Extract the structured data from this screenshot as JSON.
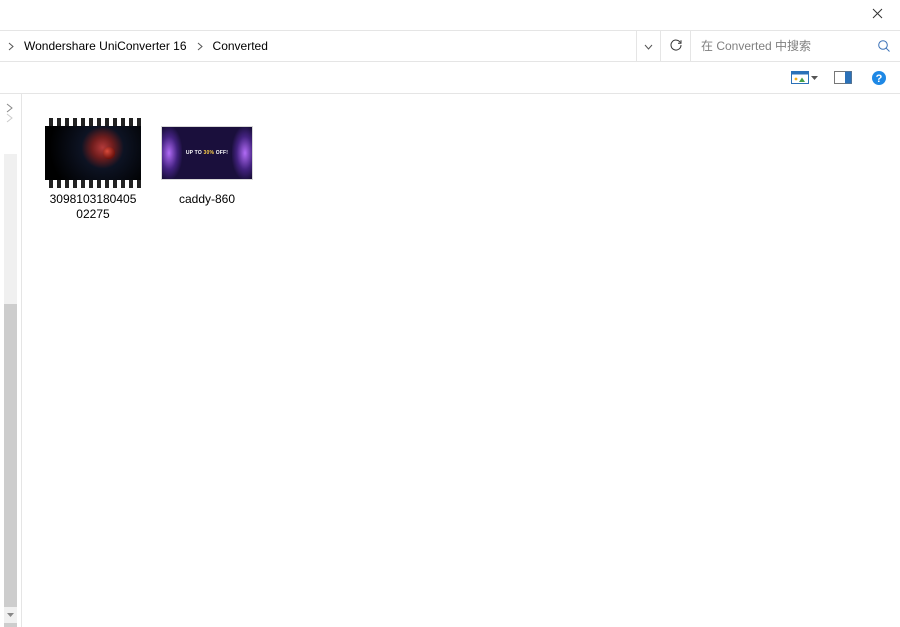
{
  "titlebar": {
    "close_label": "Close"
  },
  "address": {
    "crumb1": "Wondershare UniConverter 16",
    "crumb2": "Converted"
  },
  "search": {
    "placeholder": "在 Converted 中搜索"
  },
  "toolbar": {
    "view_label": "View options",
    "preview_label": "Preview pane",
    "help_label": "Help"
  },
  "files": [
    {
      "name": "3098103180405\n02275",
      "kind": "video"
    },
    {
      "name": "caddy-860",
      "kind": "image"
    }
  ],
  "banner": {
    "line1": "UP TO ",
    "pct": "30%",
    "line1_tail": " OFF!"
  }
}
